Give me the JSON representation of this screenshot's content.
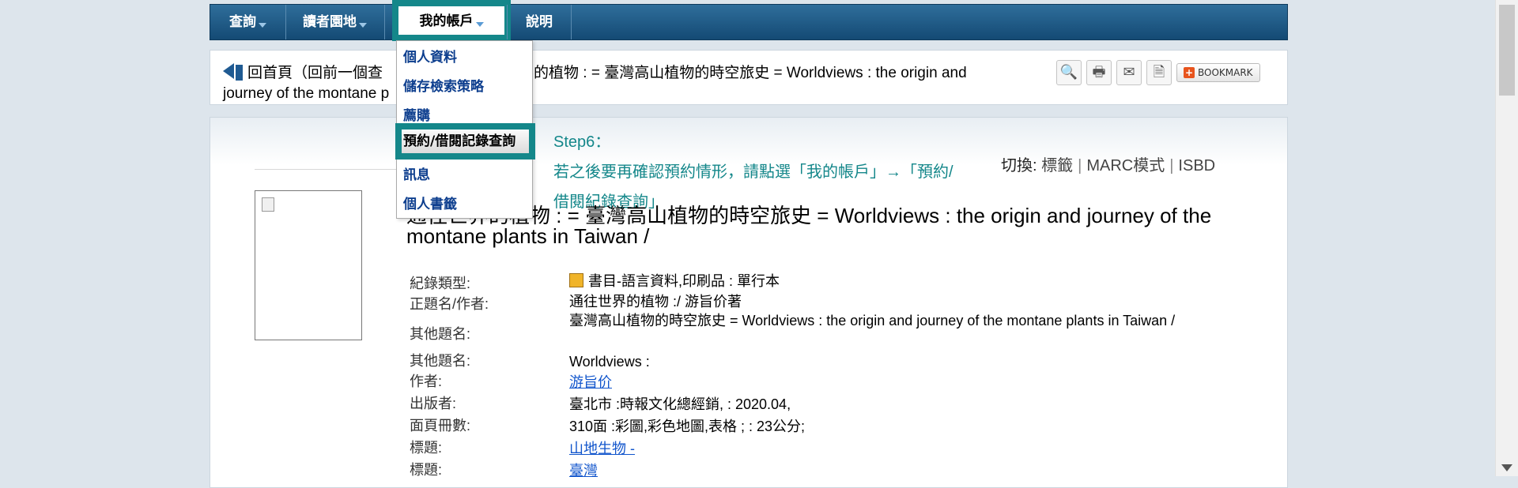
{
  "nav": {
    "items": [
      {
        "label": "查詢"
      },
      {
        "label": "讀者園地"
      },
      {
        "label": "我的帳戶"
      },
      {
        "label": "說明"
      }
    ]
  },
  "account_menu": {
    "items": [
      "個人資料",
      "儲存檢索策略",
      "薦購",
      "預約/借閱記錄查詢",
      "訊息",
      "個人書籤"
    ]
  },
  "toolbar": {
    "back_text": "回首頁（回前一個查詢結果）通往世界的植物 : = 臺灣高山植物的時空旅史 = Worldviews : the origin and journey of the montane plants in Taiwan /",
    "back_visible_1": "回首頁（回前一個查",
    "back_visible_2": "界的植物 : = 臺灣高山植物的時空旅史 = Worldviews : the origin and",
    "back_visible_3": "journey of the montane p",
    "bookmark_label": "BOOKMARK"
  },
  "instruction": {
    "step": "Step6：",
    "line1": "若之後要再確認預約情形，請點選「我的帳戶」→「預約/",
    "line2": "借閱紀錄查詢」"
  },
  "format_switch": {
    "label": "切換:",
    "options": [
      "標籤",
      "MARC模式",
      "ISBD"
    ]
  },
  "record": {
    "title": "通往世界的植物 : = 臺灣高山植物的時空旅史 = Worldviews : the origin and journey of the montane plants in Taiwan /",
    "fields": [
      {
        "label": "紀錄類型:",
        "value": "書目-語言資料,印刷品 : 單行本"
      },
      {
        "label": "正題名/作者:",
        "value": "通往世界的植物 :/ 游旨价著"
      },
      {
        "label": "其他題名:",
        "value": "臺灣高山植物的時空旅史 = Worldviews : the origin and journey of the montane plants in Taiwan /"
      },
      {
        "label": "其他題名:",
        "value": "Worldviews :"
      },
      {
        "label": "作者:",
        "value": "游旨价"
      },
      {
        "label": "出版者:",
        "value": "臺北市 :時報文化總經銷, : 2020.04,"
      },
      {
        "label": "面頁冊數:",
        "value": "310面 :彩圖,彩色地圖,表格 ; : 23公分;"
      },
      {
        "label": "標題:",
        "value": "山地生物 -"
      },
      {
        "label": "標題:",
        "value": "臺灣"
      }
    ]
  }
}
